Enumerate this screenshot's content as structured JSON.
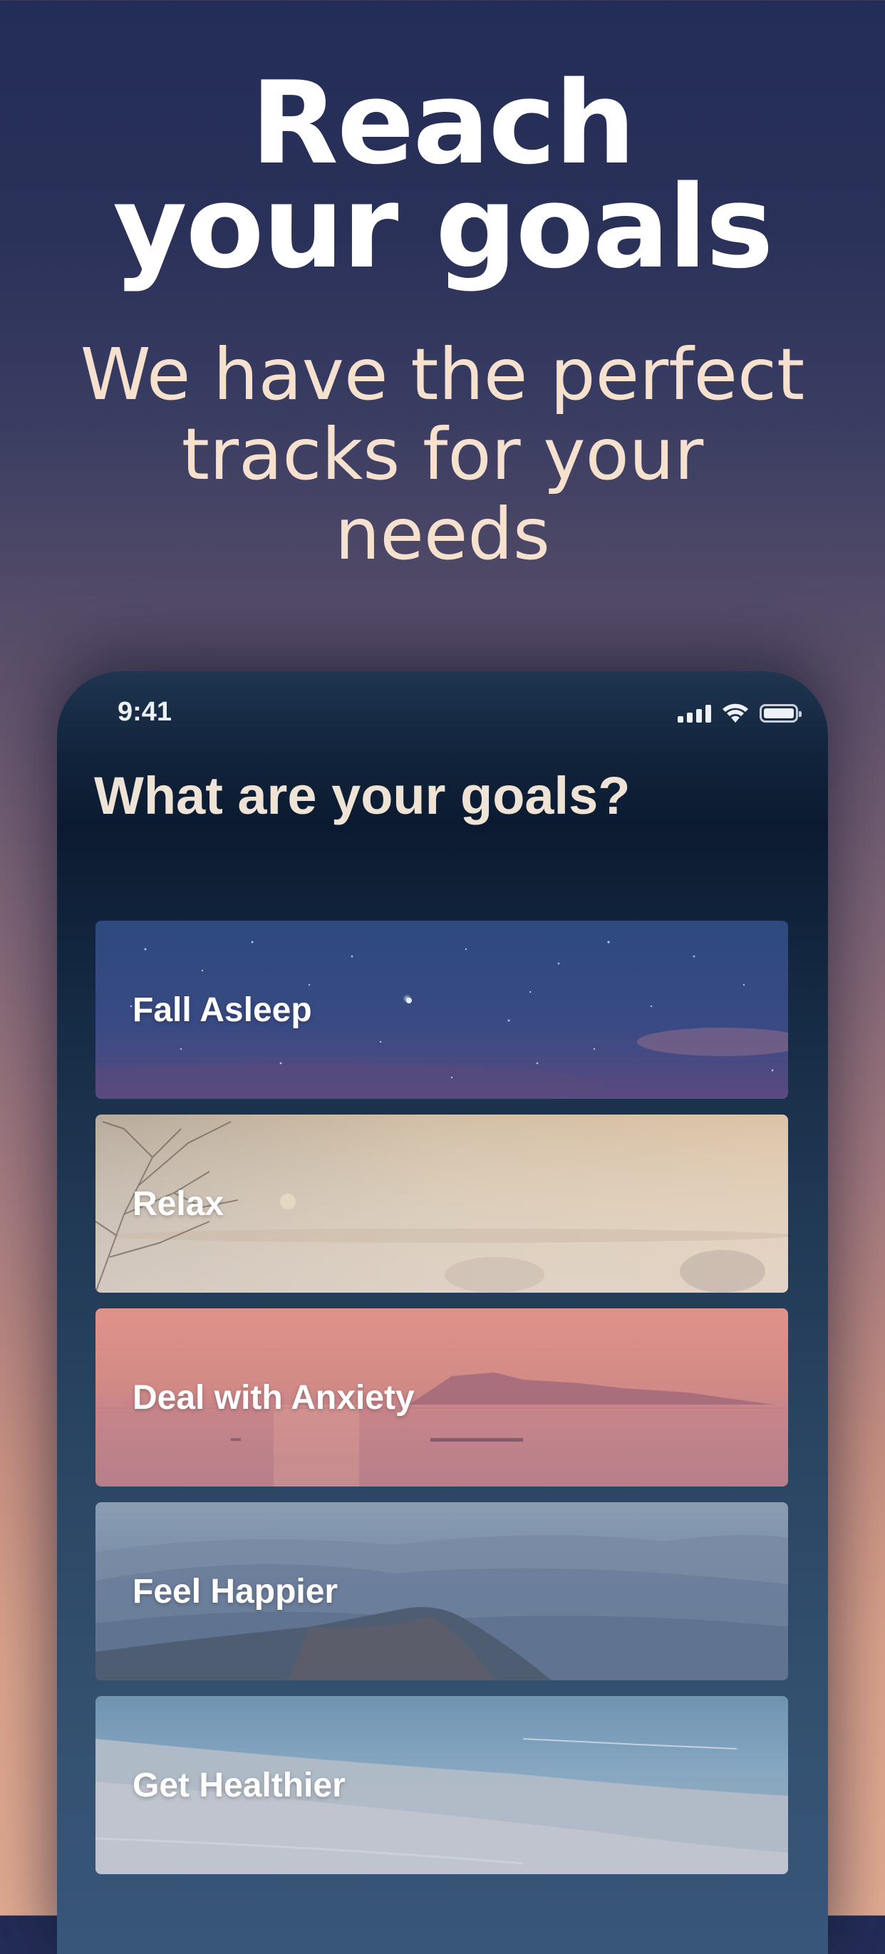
{
  "headline": {
    "line1": "Reach",
    "line2": "your goals"
  },
  "subhead": {
    "line1": "We have the perfect",
    "line2": "tracks for your",
    "line3": "needs"
  },
  "phone": {
    "status_time": "9:41",
    "title": "What are your goals?",
    "goals": [
      {
        "label": "Fall Asleep",
        "scene": "starry-night"
      },
      {
        "label": "Relax",
        "scene": "misty-tree"
      },
      {
        "label": "Deal with Anxiety",
        "scene": "pink-sunset-sea"
      },
      {
        "label": "Feel Happier",
        "scene": "blue-mountains"
      },
      {
        "label": "Get Healthier",
        "scene": "beach-shore"
      }
    ]
  },
  "colors": {
    "headline": "#ffffff",
    "subhead": "#f6e1cf",
    "phone_title": "#efe3d6"
  }
}
